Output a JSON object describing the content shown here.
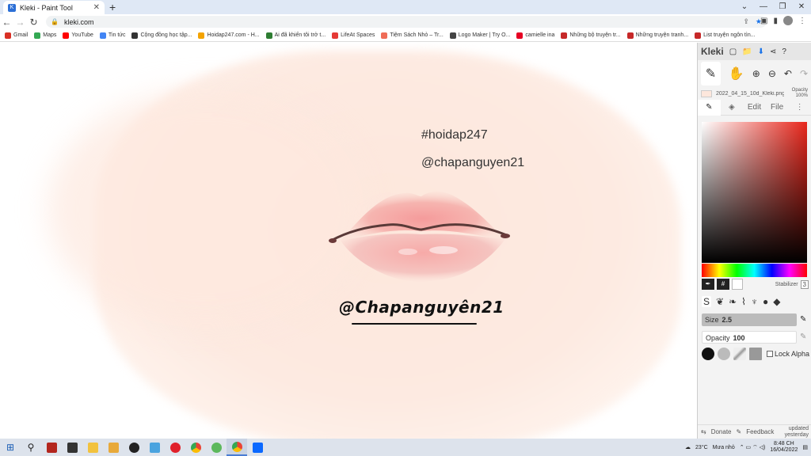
{
  "browser": {
    "tab_title": "Kleki - Paint Tool",
    "tab_close": "✕",
    "new_tab": "+",
    "url": "kleki.com",
    "window_controls": [
      "⌄",
      "—",
      "❐",
      "✕"
    ]
  },
  "bookmarks": [
    {
      "label": "Gmail",
      "color": "#d93025"
    },
    {
      "label": "Maps",
      "color": "#34a853"
    },
    {
      "label": "YouTube",
      "color": "#ff0000"
    },
    {
      "label": "Tin tức",
      "color": "#4285f4"
    },
    {
      "label": "Cộng đồng học tập...",
      "color": "#333333"
    },
    {
      "label": "Hoidap247.com - H...",
      "color": "#f4a300"
    },
    {
      "label": "Ai đã khiến tôi trở t...",
      "color": "#2e7d32"
    },
    {
      "label": "LifeAt Spaces",
      "color": "#e53935"
    },
    {
      "label": "Tiệm Sách Nhỏ – Tr...",
      "color": "#ef6c57"
    },
    {
      "label": "Logo Maker | Try O...",
      "color": "#444444"
    },
    {
      "label": "camielle ina",
      "color": "#e60023"
    },
    {
      "label": "Những bộ truyện tr...",
      "color": "#c62828"
    },
    {
      "label": "Những truyện tranh...",
      "color": "#c62828"
    },
    {
      "label": "List truyện ngôn tìn...",
      "color": "#c62828"
    }
  ],
  "canvas": {
    "hashtag": "#hoidap247",
    "handle": "@chapanguyen21",
    "signature": "@Chapanguyên21"
  },
  "panel": {
    "logo": "Kleki",
    "file_name": "2022_04_15_10d_Kleki.png",
    "layer_opacity_label": "Opacity",
    "layer_opacity_value": "100%",
    "tabs": [
      "Edit",
      "File"
    ],
    "hex_label": "#",
    "stabilizer_label": "Stabilizer",
    "stabilizer_value": "3",
    "size_label": "Size",
    "size_value": "2.5",
    "opacity_label": "Opacity",
    "opacity_value": "100",
    "lock_alpha": "Lock Alpha",
    "donate": "Donate",
    "feedback": "Feedback",
    "updated_line1": "updated",
    "updated_line2": "yesterday"
  },
  "taskbar": {
    "weather_temp": "23°C",
    "weather_desc": "Mưa nhỏ",
    "time": "8:48 CH",
    "date": "16/04/2022"
  }
}
